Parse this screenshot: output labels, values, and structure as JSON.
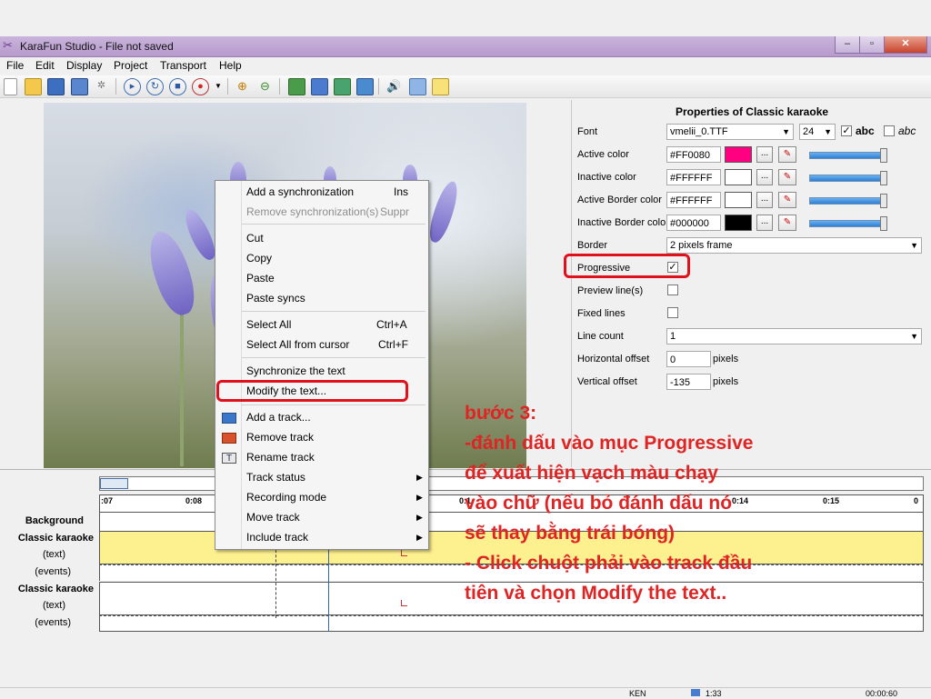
{
  "window": {
    "title": "KaraFun Studio - File not saved"
  },
  "window_controls": {
    "minimize": "–",
    "maximize": "▫",
    "close": "✕"
  },
  "menu": [
    "File",
    "Edit",
    "Display",
    "Project",
    "Transport",
    "Help"
  ],
  "toolbar_icons": [
    "new-file-icon",
    "open-folder-icon",
    "save-icon",
    "save-as-icon",
    "wizard-icon",
    "play-icon",
    "loop-icon",
    "stop-icon",
    "record-icon",
    "dropdown-arrow-icon",
    "zoom-in-icon",
    "zoom-out-icon",
    "track-icon-1",
    "track-icon-2",
    "track-icon-3",
    "track-icon-4",
    "volume-icon",
    "copy-window-icon",
    "note-icon"
  ],
  "properties": {
    "title": "Properties of Classic karaoke",
    "font_label": "Font",
    "font_value": "vmelii_0.TTF",
    "size_value": "24",
    "bold_label": "abc",
    "italic_label": "abc",
    "active_color_label": "Active color",
    "active_color_value": "#FF0080",
    "inactive_color_label": "Inactive color",
    "inactive_color_value": "#FFFFFF",
    "active_border_label": "Active Border color",
    "active_border_value": "#FFFFFF",
    "inactive_border_label": "Inactive Border colo",
    "inactive_border_value": "#000000",
    "dots": "...",
    "border_label": "Border",
    "border_value": "2 pixels frame",
    "progressive_label": "Progressive",
    "progressive_checked": "✓",
    "preview_label": "Preview line(s)",
    "fixed_label": "Fixed lines",
    "linecount_label": "Line count",
    "linecount_value": "1",
    "hoffset_label": "Horizontal offset",
    "hoffset_value": "0",
    "voffset_label": "Vertical offset",
    "voffset_value": "-135",
    "pixels": "pixels"
  },
  "context_menu": {
    "add_sync": "Add a synchronization",
    "add_sync_key": "Ins",
    "remove_sync": "Remove synchronization(s)",
    "remove_sync_key": "Suppr",
    "cut": "Cut",
    "copy": "Copy",
    "paste": "Paste",
    "paste_syncs": "Paste syncs",
    "select_all": "Select All",
    "select_all_key": "Ctrl+A",
    "select_from_cursor": "Select All from cursor",
    "select_from_cursor_key": "Ctrl+F",
    "sync_text": "Synchronize the text",
    "modify_text": "Modify the text...",
    "add_track": "Add a track...",
    "remove_track": "Remove track",
    "rename_track": "Rename track",
    "track_status": "Track status",
    "recording_mode": "Recording mode",
    "move_track": "Move track",
    "include_track": "Include track"
  },
  "timeline": {
    "ticks": [
      ":07",
      "0:08",
      "0:1",
      "0:14",
      "0:15",
      "0"
    ],
    "background_label": "Background",
    "track1_name": "Classic karaoke",
    "track1_text": "(text)",
    "track1_events": "(events)",
    "track2_name": "Classic karaoke",
    "track2_text": "(text)",
    "track2_events": "(events)"
  },
  "annotation": [
    "bước 3:",
    "-đánh dấu vào mục Progressive",
    "để xuất hiện vạch màu chạy",
    "vào chữ (nếu bỏ đánh dấu nó",
    "sẽ thay bằng trái bóng)",
    "- Click chuột phải vào track đầu",
    "tiên và chọn Modify the text.."
  ],
  "status": {
    "kbd": "KEN",
    "pos": "1:33",
    "time": "00:00:60"
  },
  "colors": {
    "accent_red": "#e0111b",
    "active_pink": "#FF0080",
    "track_yellow": "#fdf08f"
  }
}
